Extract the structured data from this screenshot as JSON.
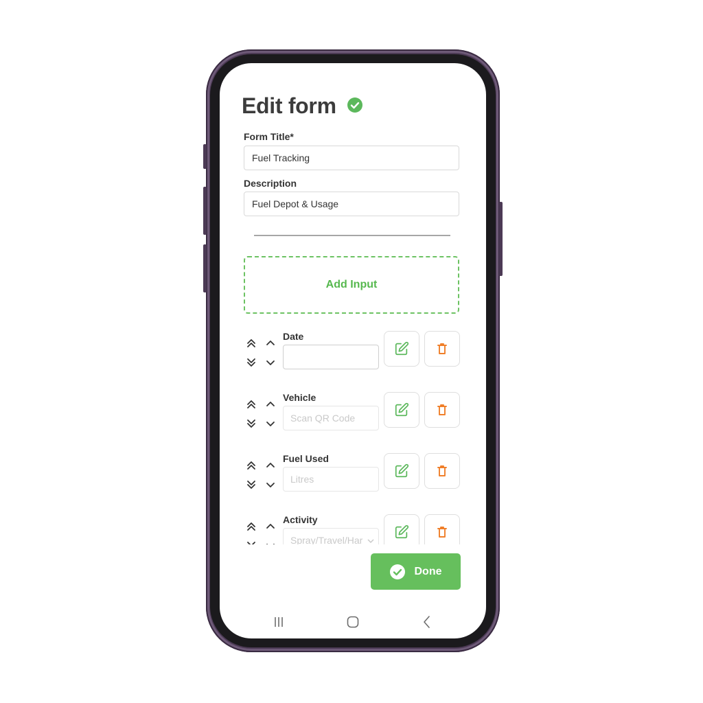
{
  "header": {
    "title": "Edit form",
    "status_icon": "check-circle-icon",
    "accent": "#5cb85c"
  },
  "form": {
    "title_label": "Form Title*",
    "title_value": "Fuel Tracking",
    "description_label": "Description",
    "description_value": "Fuel Depot & Usage"
  },
  "add_input": {
    "label": "Add Input"
  },
  "inputs": [
    {
      "label": "Date",
      "placeholder": ""
    },
    {
      "label": "Vehicle",
      "placeholder": "Scan QR Code"
    },
    {
      "label": "Fuel Used",
      "placeholder": "Litres"
    },
    {
      "label": "Activity",
      "placeholder": "Spray/Travel/Har"
    }
  ],
  "row_actions": {
    "edit_icon": "edit-icon",
    "delete_icon": "trash-icon",
    "edit_color": "#5cb85c",
    "delete_color": "#f07f2a"
  },
  "done": {
    "label": "Done",
    "color": "#66bf5d"
  },
  "nav": {
    "recents_icon": "recents-icon",
    "home_icon": "home-icon",
    "back_icon": "back-icon"
  }
}
